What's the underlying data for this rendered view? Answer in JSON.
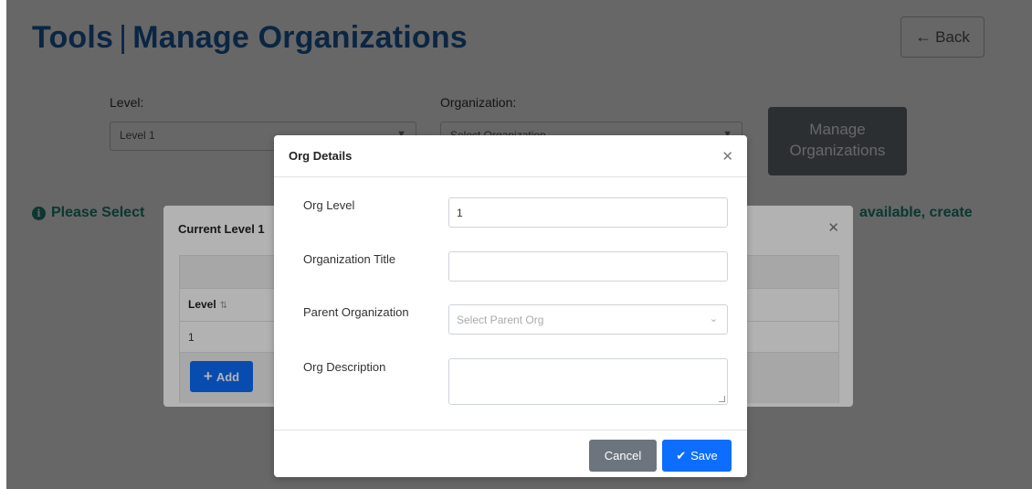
{
  "page": {
    "title_part1": "Tools",
    "title_sep": "|",
    "title_part2": "Manage Organizations",
    "back_label": "Back"
  },
  "filters": {
    "level_label": "Level:",
    "level_value": "Level 1",
    "organization_label": "Organization:",
    "organization_value": "Select Organization"
  },
  "manage_button_line1": "Manage",
  "manage_button_line2": "Organizations",
  "info": {
    "left_text": "Please Select",
    "right_text": "available, create"
  },
  "level_panel": {
    "title": "Current Level 1",
    "column_header": "Level",
    "row_value": "1",
    "add_label": "Add"
  },
  "org_details": {
    "title": "Org Details",
    "org_level_label": "Org Level",
    "org_level_value": "1",
    "org_title_label": "Organization Title",
    "org_title_value": "",
    "parent_label": "Parent Organization",
    "parent_placeholder": "Select Parent Org",
    "description_label": "Org Description",
    "description_value": "",
    "cancel_label": "Cancel",
    "save_label": "Save"
  },
  "colors": {
    "title_blue": "#1a5fa8",
    "info_green": "#1f8a7a",
    "primary": "#0d6efd",
    "secondary": "#6c757d"
  },
  "icons": [
    "arrow-left-icon",
    "chevron-down-icon",
    "info-icon",
    "sort-icon",
    "plus-icon",
    "close-icon",
    "check-icon"
  ]
}
